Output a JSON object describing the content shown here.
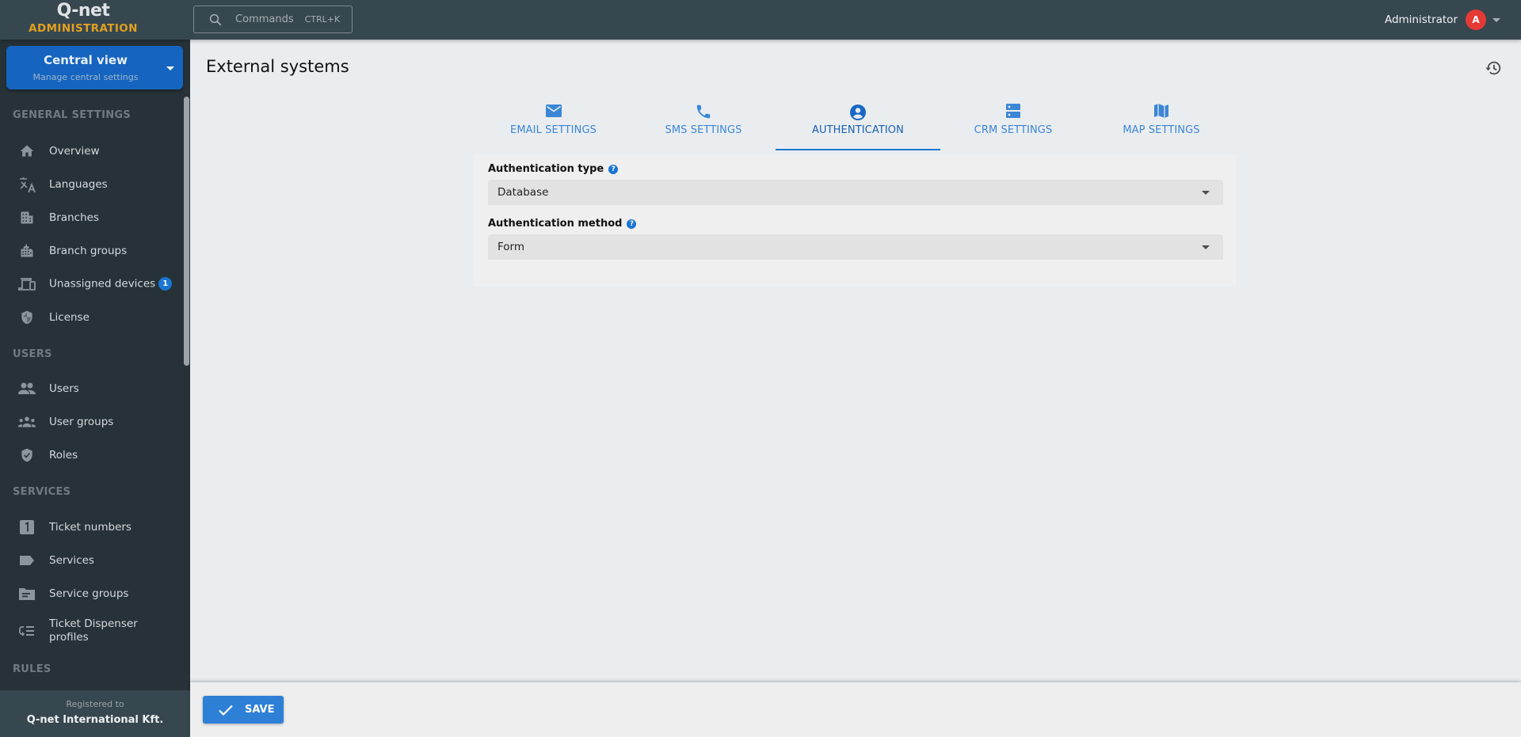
{
  "app": {
    "logo_main": "Q-net",
    "logo_sub": "ADMINISTRATION"
  },
  "header": {
    "search_label": "Commands",
    "search_shortcut": "CTRL+K",
    "user_name": "Administrator",
    "avatar_initial": "A"
  },
  "sidebar": {
    "context": {
      "title": "Central view",
      "subtitle": "Manage central settings"
    },
    "sections": [
      {
        "label": "GENERAL SETTINGS",
        "items": [
          {
            "label": "Overview",
            "icon": "home-icon"
          },
          {
            "label": "Languages",
            "icon": "translate-icon"
          },
          {
            "label": "Branches",
            "icon": "building-icon"
          },
          {
            "label": "Branch groups",
            "icon": "buildings-icon"
          },
          {
            "label": "Unassigned devices",
            "icon": "devices-icon",
            "badge": "1"
          },
          {
            "label": "License",
            "icon": "shield-icon"
          }
        ]
      },
      {
        "label": "USERS",
        "items": [
          {
            "label": "Users",
            "icon": "users-icon"
          },
          {
            "label": "User groups",
            "icon": "user-groups-icon"
          },
          {
            "label": "Roles",
            "icon": "shield-check-icon"
          }
        ]
      },
      {
        "label": "SERVICES",
        "items": [
          {
            "label": "Ticket numbers",
            "icon": "number-one-icon"
          },
          {
            "label": "Services",
            "icon": "label-icon"
          },
          {
            "label": "Service groups",
            "icon": "folder-icon"
          },
          {
            "label": "Ticket Dispenser profiles",
            "icon": "dispenser-list-icon"
          }
        ]
      },
      {
        "label": "RULES",
        "items": []
      }
    ],
    "footer": {
      "registered_label": "Registered to",
      "registered_name": "Q-net International Kft."
    }
  },
  "main": {
    "title": "External systems",
    "tabs": [
      {
        "label": "EMAIL SETTINGS",
        "icon": "email-icon",
        "active": false
      },
      {
        "label": "SMS SETTINGS",
        "icon": "phone-icon",
        "active": false
      },
      {
        "label": "AUTHENTICATION",
        "icon": "account-circle-icon",
        "active": true
      },
      {
        "label": "CRM SETTINGS",
        "icon": "server-icon",
        "active": false
      },
      {
        "label": "MAP SETTINGS",
        "icon": "map-icon",
        "active": false
      }
    ],
    "fields": [
      {
        "label": "Authentication type",
        "value": "Database"
      },
      {
        "label": "Authentication method",
        "value": "Form"
      }
    ],
    "help_glyph": "?"
  },
  "actions": {
    "save_label": "SAVE"
  },
  "colors": {
    "header_bg": "#37474f",
    "sidebar_bg": "#263238",
    "accent": "#1976d2",
    "context_button": "#1565c0",
    "logo_accent": "#e0a020",
    "avatar": "#e53935",
    "save_button": "#2e80d6"
  }
}
